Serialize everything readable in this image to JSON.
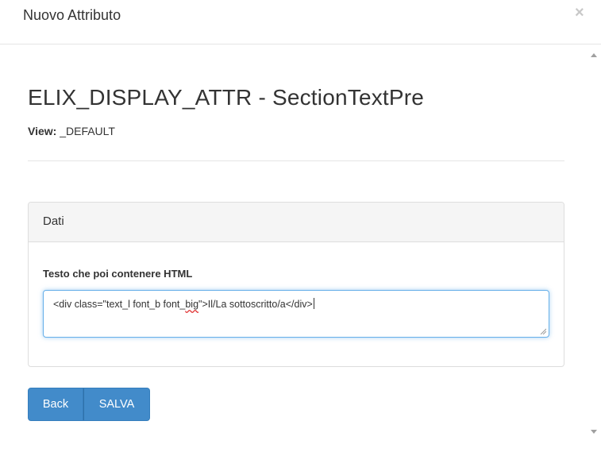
{
  "modal": {
    "title": "Nuovo Attributo",
    "close_glyph": "×"
  },
  "header": {
    "title": "ELIX_DISPLAY_ATTR - SectionTextPre",
    "view_label": "View:",
    "view_value": "_DEFAULT"
  },
  "panel": {
    "heading": "Dati",
    "field_label": "Testo che poi contenere HTML",
    "textarea_value_pre": "<div class=\"text_l font_b font_",
    "textarea_value_flagged": "big",
    "textarea_value_post": "\">Il/La sottoscritto/a</div>"
  },
  "buttons": {
    "back": "Back",
    "save": "SALVA"
  },
  "colors": {
    "primary": "#428bca",
    "focus_border": "#66afe9",
    "panel_heading_bg": "#f5f5f5"
  }
}
